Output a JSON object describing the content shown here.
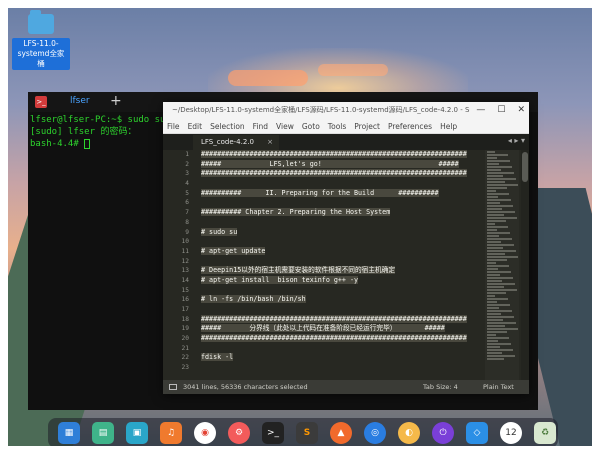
{
  "desktop": {
    "folder_label_1": "LFS-11.0-",
    "folder_label_2": "systemd全家桶"
  },
  "terminal": {
    "tab_label": "lfser",
    "new_tab": "+",
    "lines": [
      "lfser@lfser-PC:~$ sudo su",
      "[sudo] lfser 的密码：",
      "bash-4.4# "
    ]
  },
  "sublime": {
    "title": "~/Desktop/LFS-11.0-systemd全家桶/LFS源码/LFS-11.0-systemd源码/LFS_code-4.2.0 - Sublime Text",
    "menu": [
      "File",
      "Edit",
      "Selection",
      "Find",
      "View",
      "Goto",
      "Tools",
      "Project",
      "Preferences",
      "Help"
    ],
    "tab": "LFS_code-4.2.0",
    "tab_close": "×",
    "tab_nav": "◂ ▸ ▾",
    "code_lines": [
      {
        "n": "1",
        "t": "##################################################################"
      },
      {
        "n": "2",
        "t": "#####            LFS,let's go!                             #####"
      },
      {
        "n": "3",
        "t": "##################################################################"
      },
      {
        "n": "4",
        "t": ""
      },
      {
        "n": "5",
        "t": "##########      II. Preparing for the Build      ##########"
      },
      {
        "n": "6",
        "t": ""
      },
      {
        "n": "7",
        "t": "########## Chapter 2. Preparing the Host System"
      },
      {
        "n": "8",
        "t": ""
      },
      {
        "n": "9",
        "t": "# sudo su"
      },
      {
        "n": "10",
        "t": ""
      },
      {
        "n": "11",
        "t": "# apt-get update"
      },
      {
        "n": "12",
        "t": ""
      },
      {
        "n": "13",
        "t": "# Deepin15以外的宿主机需要安装的软件根据不同的宿主机确定"
      },
      {
        "n": "14",
        "t": "# apt-get install  bison texinfo g++ -y"
      },
      {
        "n": "15",
        "t": ""
      },
      {
        "n": "16",
        "t": "# ln -fs /bin/bash /bin/sh"
      },
      {
        "n": "17",
        "t": ""
      },
      {
        "n": "18",
        "t": "##################################################################"
      },
      {
        "n": "19",
        "t": "#####       分界线（此处以上代码在准备阶段已经运行完毕）       #####"
      },
      {
        "n": "20",
        "t": "##################################################################"
      },
      {
        "n": "21",
        "t": ""
      },
      {
        "n": "22",
        "t": "fdisk -l"
      },
      {
        "n": "23",
        "t": ""
      }
    ],
    "status_lines": "3041 lines, 56336 characters selected",
    "status_tab": "Tab Size: 4",
    "status_syntax": "Plain Text"
  },
  "dock": {
    "items": [
      "launcher-icon",
      "file-manager-icon",
      "app-store-icon",
      "music-icon",
      "chrome-icon",
      "settings-icon",
      "terminal-icon",
      "sublime-text-icon",
      "upload-icon",
      "screenshot-icon",
      "vpn-icon",
      "power-icon",
      "system-monitor-icon",
      "clock-icon",
      "trash-icon"
    ],
    "clock_label": "12"
  }
}
